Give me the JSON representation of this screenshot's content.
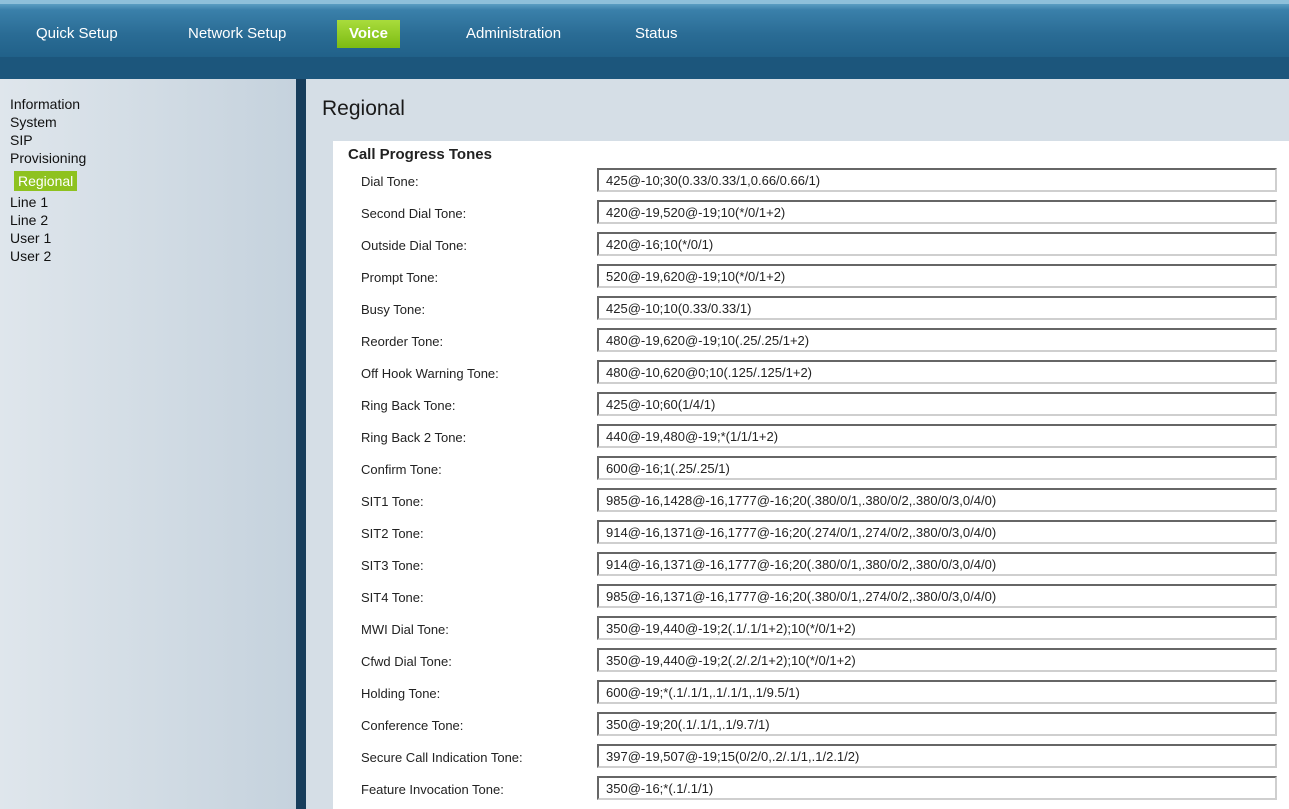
{
  "topnav": {
    "tabs": [
      {
        "label": "Quick Setup"
      },
      {
        "label": "Network Setup"
      },
      {
        "label": "Voice",
        "active": true
      },
      {
        "label": "Administration"
      },
      {
        "label": "Status"
      }
    ]
  },
  "sidebar": {
    "items": [
      {
        "label": "Information"
      },
      {
        "label": "System"
      },
      {
        "label": "SIP"
      },
      {
        "label": "Provisioning"
      },
      {
        "label": "Regional",
        "active": true
      },
      {
        "label": "Line 1"
      },
      {
        "label": "Line 2"
      },
      {
        "label": "User 1"
      },
      {
        "label": "User 2"
      }
    ]
  },
  "page": {
    "title": "Regional",
    "section_title": "Call Progress Tones"
  },
  "tones": [
    {
      "label": "Dial Tone:",
      "value": "425@-10;30(0.33/0.33/1,0.66/0.66/1)"
    },
    {
      "label": "Second Dial Tone:",
      "value": "420@-19,520@-19;10(*/0/1+2)"
    },
    {
      "label": "Outside Dial Tone:",
      "value": "420@-16;10(*/0/1)"
    },
    {
      "label": "Prompt Tone:",
      "value": "520@-19,620@-19;10(*/0/1+2)"
    },
    {
      "label": "Busy Tone:",
      "value": "425@-10;10(0.33/0.33/1)"
    },
    {
      "label": "Reorder Tone:",
      "value": "480@-19,620@-19;10(.25/.25/1+2)"
    },
    {
      "label": "Off Hook Warning Tone:",
      "value": "480@-10,620@0;10(.125/.125/1+2)"
    },
    {
      "label": "Ring Back Tone:",
      "value": "425@-10;60(1/4/1)"
    },
    {
      "label": "Ring Back 2 Tone:",
      "value": "440@-19,480@-19;*(1/1/1+2)"
    },
    {
      "label": "Confirm Tone:",
      "value": "600@-16;1(.25/.25/1)"
    },
    {
      "label": "SIT1 Tone:",
      "value": "985@-16,1428@-16,1777@-16;20(.380/0/1,.380/0/2,.380/0/3,0/4/0)"
    },
    {
      "label": "SIT2 Tone:",
      "value": "914@-16,1371@-16,1777@-16;20(.274/0/1,.274/0/2,.380/0/3,0/4/0)"
    },
    {
      "label": "SIT3 Tone:",
      "value": "914@-16,1371@-16,1777@-16;20(.380/0/1,.380/0/2,.380/0/3,0/4/0)"
    },
    {
      "label": "SIT4 Tone:",
      "value": "985@-16,1371@-16,1777@-16;20(.380/0/1,.274/0/2,.380/0/3,0/4/0)"
    },
    {
      "label": "MWI Dial Tone:",
      "value": "350@-19,440@-19;2(.1/.1/1+2);10(*/0/1+2)"
    },
    {
      "label": "Cfwd Dial Tone:",
      "value": "350@-19,440@-19;2(.2/.2/1+2);10(*/0/1+2)"
    },
    {
      "label": "Holding Tone:",
      "value": "600@-19;*(.1/.1/1,.1/.1/1,.1/9.5/1)"
    },
    {
      "label": "Conference Tone:",
      "value": "350@-19;20(.1/.1/1,.1/9.7/1)"
    },
    {
      "label": "Secure Call Indication Tone:",
      "value": "397@-19,507@-19;15(0/2/0,.2/.1/1,.1/2.1/2)"
    },
    {
      "label": "Feature Invocation Tone:",
      "value": "350@-16;*(.1/.1/1)"
    }
  ]
}
